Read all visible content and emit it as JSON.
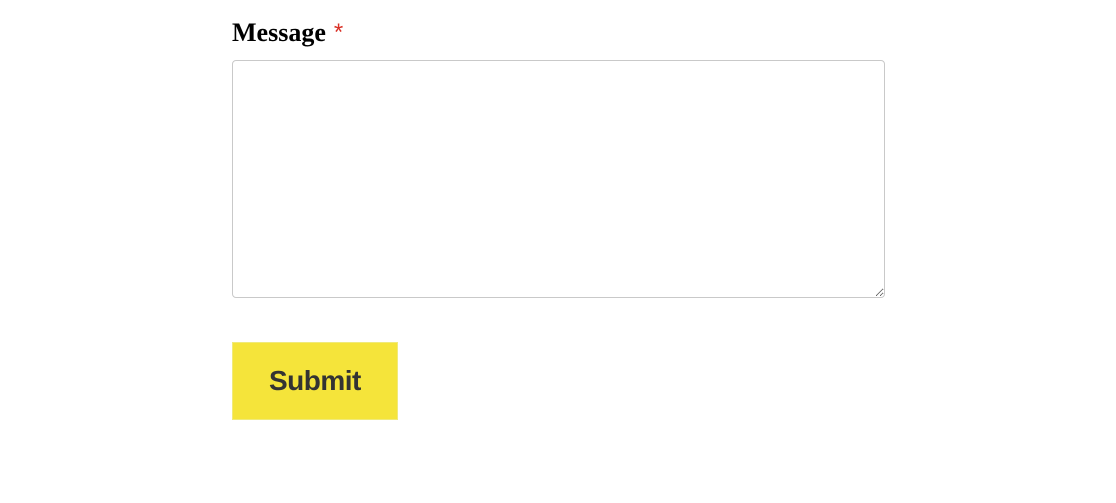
{
  "form": {
    "message_label": "Message",
    "required_mark": "*",
    "message_value": "",
    "submit_label": "Submit"
  }
}
